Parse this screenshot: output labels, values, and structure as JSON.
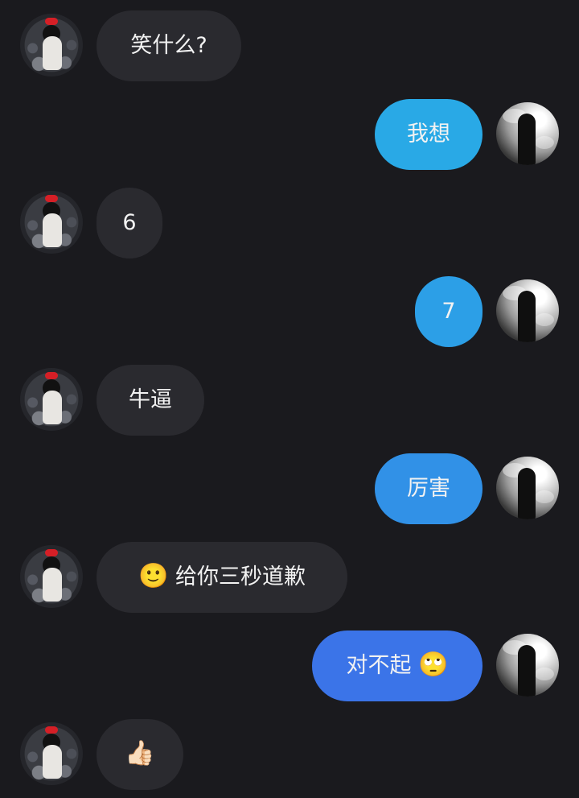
{
  "theme": {
    "background": "#1a1a1e",
    "incoming_bubble": "#2a2a2f",
    "outgoing_bubble_light": "#29a9e6",
    "outgoing_bubble_dark": "#3b74e8",
    "text_color": "#f2f2f2"
  },
  "messages": [
    {
      "side": "in",
      "text": "笑什么?",
      "emoji": ""
    },
    {
      "side": "out",
      "text": "我想",
      "emoji": ""
    },
    {
      "side": "in",
      "text": "6",
      "emoji": ""
    },
    {
      "side": "out",
      "text": "7",
      "emoji": ""
    },
    {
      "side": "in",
      "text": "牛逼",
      "emoji": ""
    },
    {
      "side": "out",
      "text": "厉害",
      "emoji": ""
    },
    {
      "side": "in",
      "text": "给你三秒道歉",
      "emoji": "🙂"
    },
    {
      "side": "out",
      "text": "对不起",
      "emoji": "🙄"
    },
    {
      "side": "in",
      "text": "",
      "emoji": "👍🏻"
    }
  ]
}
